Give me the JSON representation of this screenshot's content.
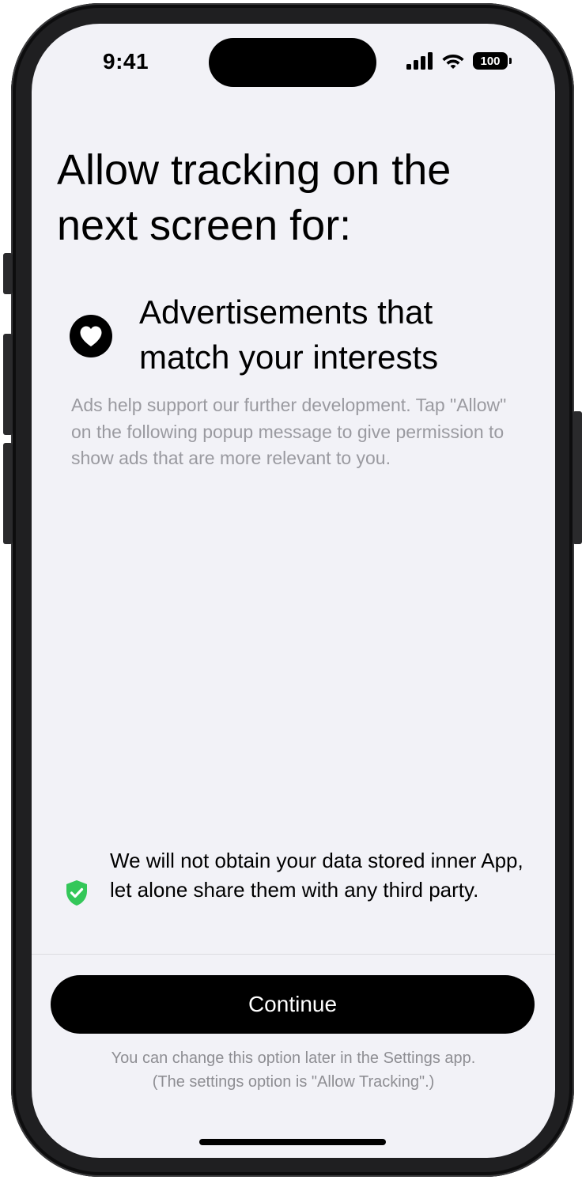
{
  "status_bar": {
    "time": "9:41",
    "battery": "100",
    "icons": [
      "cellular-signal-icon",
      "wifi-icon",
      "battery-icon"
    ]
  },
  "title": "Allow tracking on the next screen for:",
  "feature": {
    "icon": "heart-icon",
    "title": "Advertisements that match your interests",
    "description": "Ads help support our further development. Tap \"Allow\" on the following popup message to give permission to show ads that are more relevant to you."
  },
  "privacy": {
    "icon": "shield-check-icon",
    "icon_color": "#34c759",
    "text": "We will not obtain your data stored inner App, let alone share them with any third party."
  },
  "continue_button": {
    "label": "Continue"
  },
  "footnote": {
    "line1": "You can change this option later in the Settings app.",
    "line2": "(The settings option is \"Allow Tracking\".)"
  },
  "colors": {
    "background": "#f2f2f7",
    "primary": "#000000",
    "secondary_text": "#9a9aa0",
    "accent_green": "#34c759"
  }
}
